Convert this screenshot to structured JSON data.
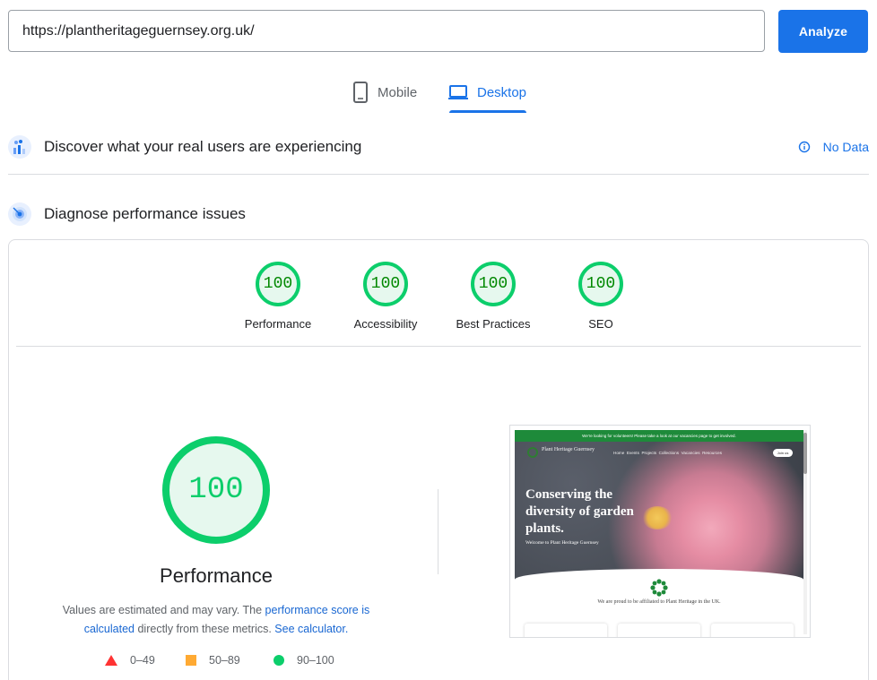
{
  "search": {
    "url_value": "https://plantheritageguernsey.org.uk/",
    "analyze_label": "Analyze"
  },
  "tabs": [
    {
      "label": "Mobile",
      "icon": "phone-icon",
      "active": false
    },
    {
      "label": "Desktop",
      "icon": "laptop-icon",
      "active": true
    }
  ],
  "field_data": {
    "title": "Discover what your real users are experiencing",
    "status": "No Data",
    "icon": "users-chart-icon",
    "status_icon": "info-icon"
  },
  "diagnose": {
    "title": "Diagnose performance issues",
    "icon": "radar-icon"
  },
  "scores": [
    {
      "label": "Performance",
      "value": "100"
    },
    {
      "label": "Accessibility",
      "value": "100"
    },
    {
      "label": "Best Practices",
      "value": "100"
    },
    {
      "label": "SEO",
      "value": "100"
    }
  ],
  "performance": {
    "score": "100",
    "title": "Performance",
    "desc_part1": "Values are estimated and may vary. The ",
    "desc_link1": "performance score is calculated",
    "desc_part2": " directly from these metrics. ",
    "desc_link2": "See calculator."
  },
  "legend": [
    {
      "range": "0–49",
      "shape": "triangle",
      "color": "#ff3333"
    },
    {
      "range": "50–89",
      "shape": "square",
      "color": "#ffaa33"
    },
    {
      "range": "90–100",
      "shape": "circle",
      "color": "#0cce6b"
    }
  ],
  "colors": {
    "accent": "#1a73e8",
    "pass": "#0cce6b",
    "pass_text": "#008800"
  },
  "screenshot": {
    "banner": "We're looking for volunteers! Please take a look at our vacancies page to get involved.",
    "logo": "Plant Heritage Guernsey",
    "nav": [
      "Home",
      "Events",
      "Projects",
      "Collections",
      "Vacancies",
      "Resources"
    ],
    "join": "Join us",
    "headline": "Conserving the diversity of garden plants.",
    "welcome": "Welcome to Plant Heritage Guernsey",
    "affiliated": "We are proud to be affiliated to Plant Heritage in the UK."
  }
}
